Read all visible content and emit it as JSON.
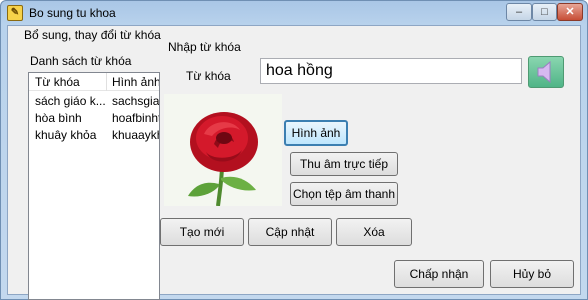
{
  "window": {
    "title": "Bo sung tu khoa",
    "icon": "app-icon",
    "controls": {
      "minimize": "–",
      "maximize": "□",
      "close": "✕"
    }
  },
  "outer_group": {
    "title": "Bổ sung, thay đổi từ khóa"
  },
  "list_group": {
    "title": "Danh sách từ khóa",
    "columns": [
      "Từ khóa",
      "Hình ảnh"
    ],
    "rows": [
      [
        "sách giáo k...",
        "sachsgia"
      ],
      [
        "hòa bình",
        "hoafbinht"
      ],
      [
        "khuây khỏa",
        "khuaaykh"
      ]
    ]
  },
  "input_group": {
    "title": "Nhập từ khóa",
    "keyword_label": "Từ khóa",
    "keyword_value": "hoa hồng",
    "speaker_icon": "speaker-icon",
    "image_alt": "rose-image",
    "image_button": "Hình ảnh",
    "record_button": "Thu âm trực tiếp",
    "choose_sound_button": "Chọn tệp âm thanh"
  },
  "actions": {
    "new": "Tạo mới",
    "update": "Cập nhật",
    "delete": "Xóa"
  },
  "dialog_buttons": {
    "accept": "Chấp nhận",
    "cancel": "Hủy bỏ"
  }
}
